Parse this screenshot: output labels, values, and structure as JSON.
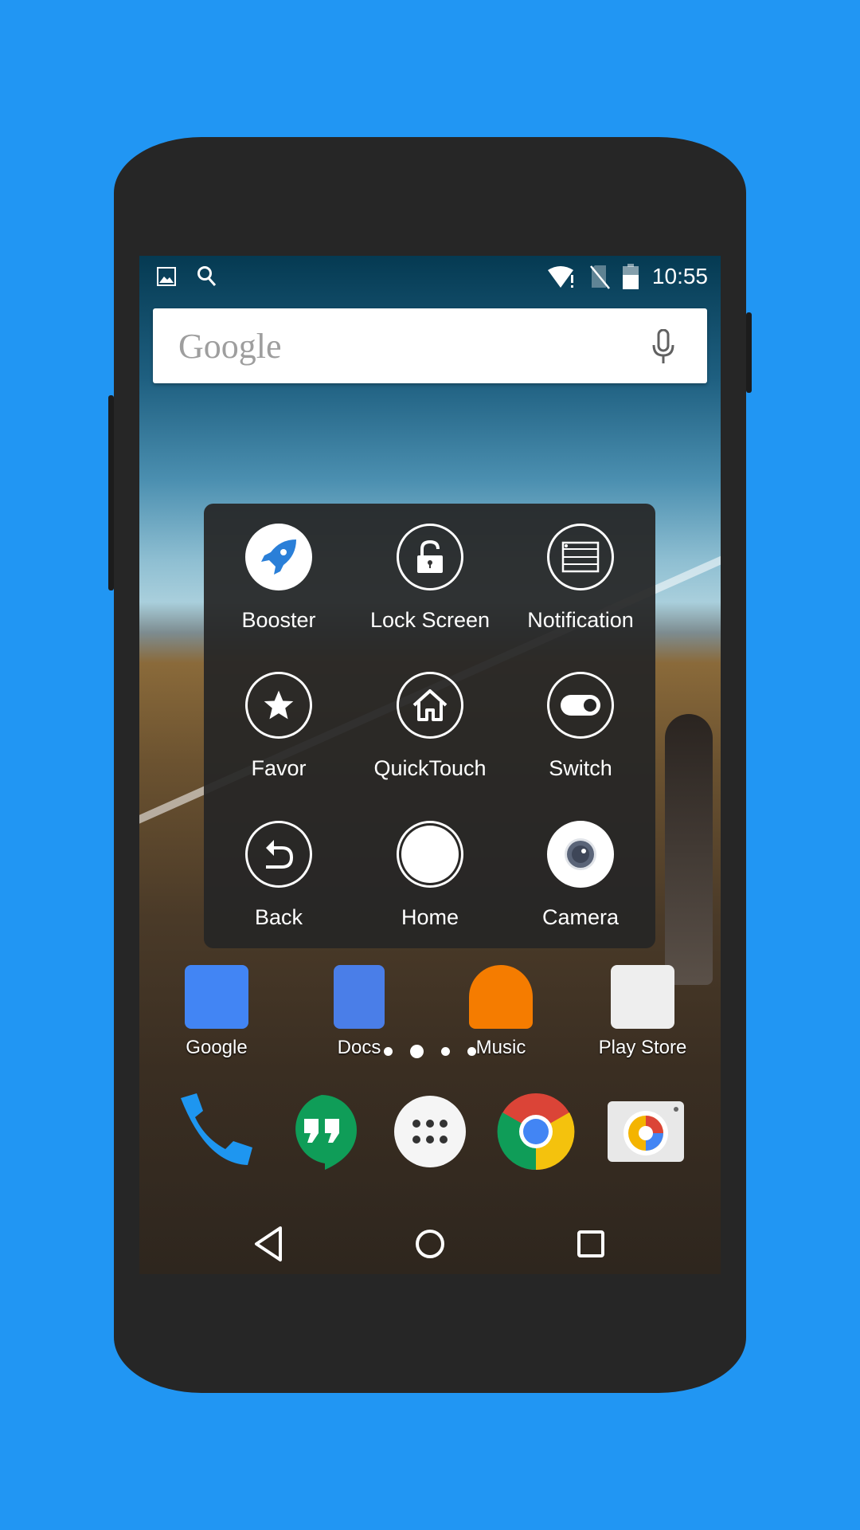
{
  "status_bar": {
    "time": "10:55",
    "left_icons": [
      "image-icon",
      "search-icon"
    ],
    "right_icons": [
      "wifi-alert-icon",
      "no-sim-icon",
      "battery-icon"
    ]
  },
  "search": {
    "logo": "Google",
    "icon": "mic-icon"
  },
  "quick_panel": {
    "items": [
      {
        "label": "Booster",
        "icon": "rocket-icon"
      },
      {
        "label": "Lock Screen",
        "icon": "lock-icon"
      },
      {
        "label": "Notification",
        "icon": "notification-icon"
      },
      {
        "label": "Favor",
        "icon": "star-icon"
      },
      {
        "label": "QuickTouch",
        "icon": "house-icon"
      },
      {
        "label": "Switch",
        "icon": "toggle-icon"
      },
      {
        "label": "Back",
        "icon": "back-arrow-icon"
      },
      {
        "label": "Home",
        "icon": "home-circle-icon"
      },
      {
        "label": "Camera",
        "icon": "camera-lens-icon"
      }
    ]
  },
  "home_apps": [
    {
      "label": "Google"
    },
    {
      "label": "Docs"
    },
    {
      "label": "Music"
    },
    {
      "label": "Play Store"
    }
  ],
  "page_indicator": {
    "pages": 4,
    "current": 2
  },
  "dock": [
    "phone-icon",
    "hangouts-icon",
    "app-drawer-icon",
    "chrome-icon",
    "camera-icon"
  ],
  "nav": [
    "back-icon",
    "home-icon",
    "recents-icon"
  ],
  "colors": {
    "background": "#2196f3",
    "phone": "#262626",
    "booster": "#2a7fd8"
  }
}
